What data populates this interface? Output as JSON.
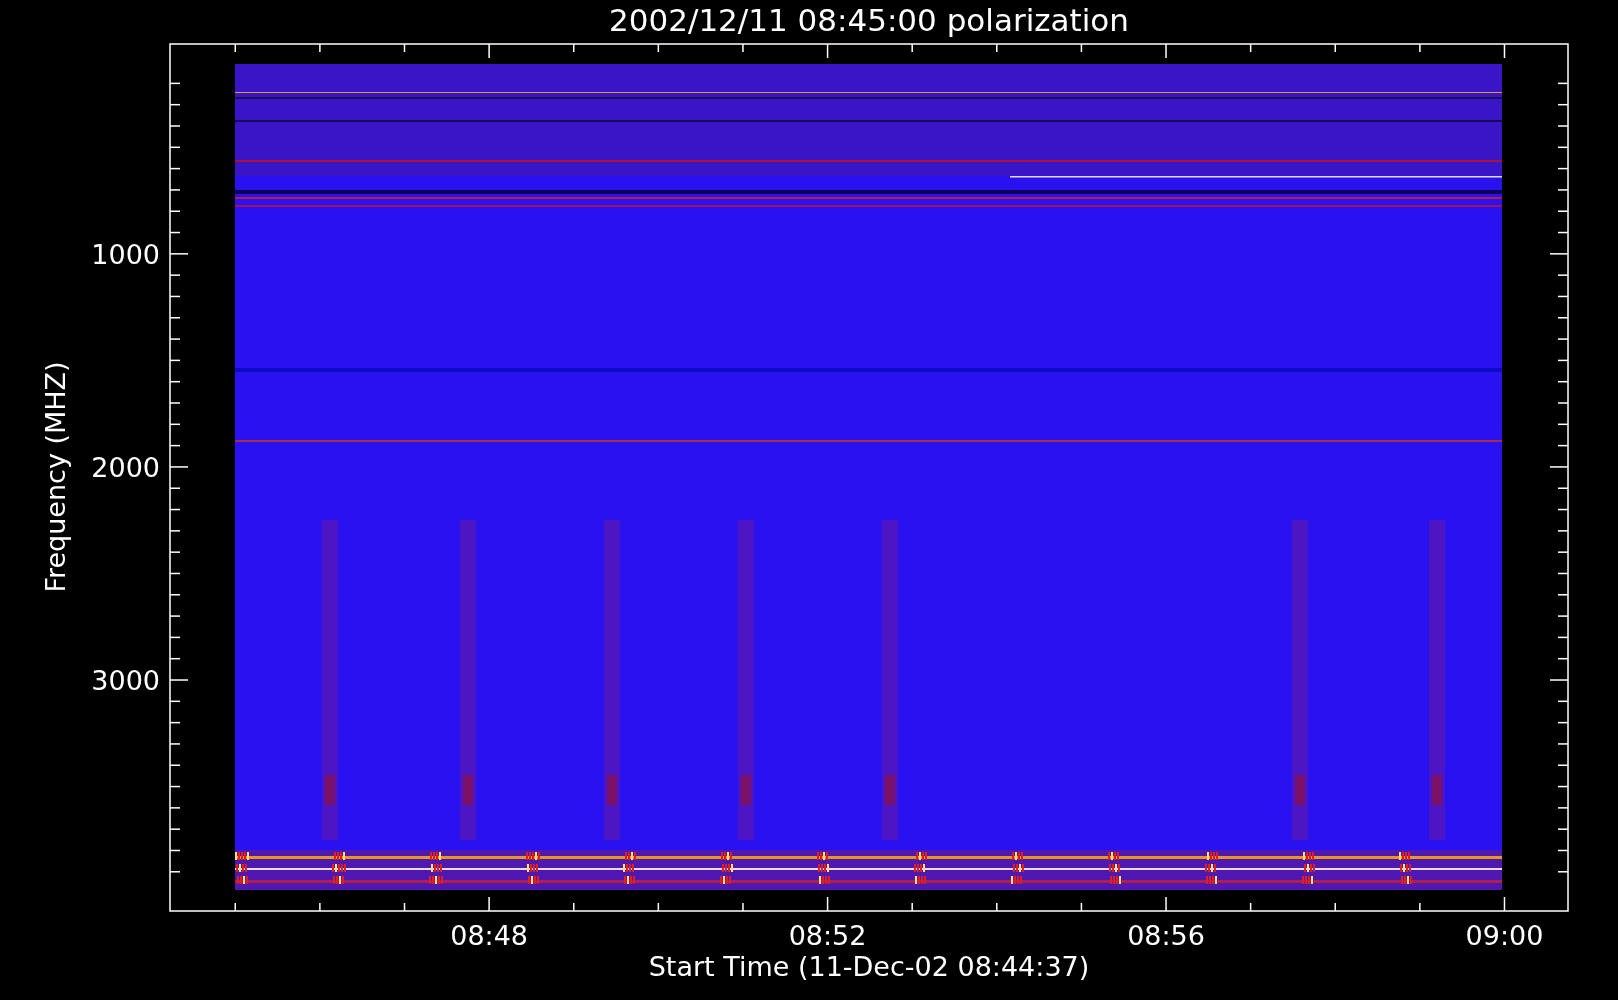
{
  "title": "2002/12/11 08:45:00 polarization",
  "y_axis": {
    "label": "Frequency (MHZ)",
    "tick_labels": [
      "1000",
      "2000",
      "3000"
    ]
  },
  "x_axis": {
    "label": "Start Time (11-Dec-02 08:44:37)",
    "tick_labels": [
      "08:48",
      "08:52",
      "08:56",
      "09:00"
    ]
  }
}
